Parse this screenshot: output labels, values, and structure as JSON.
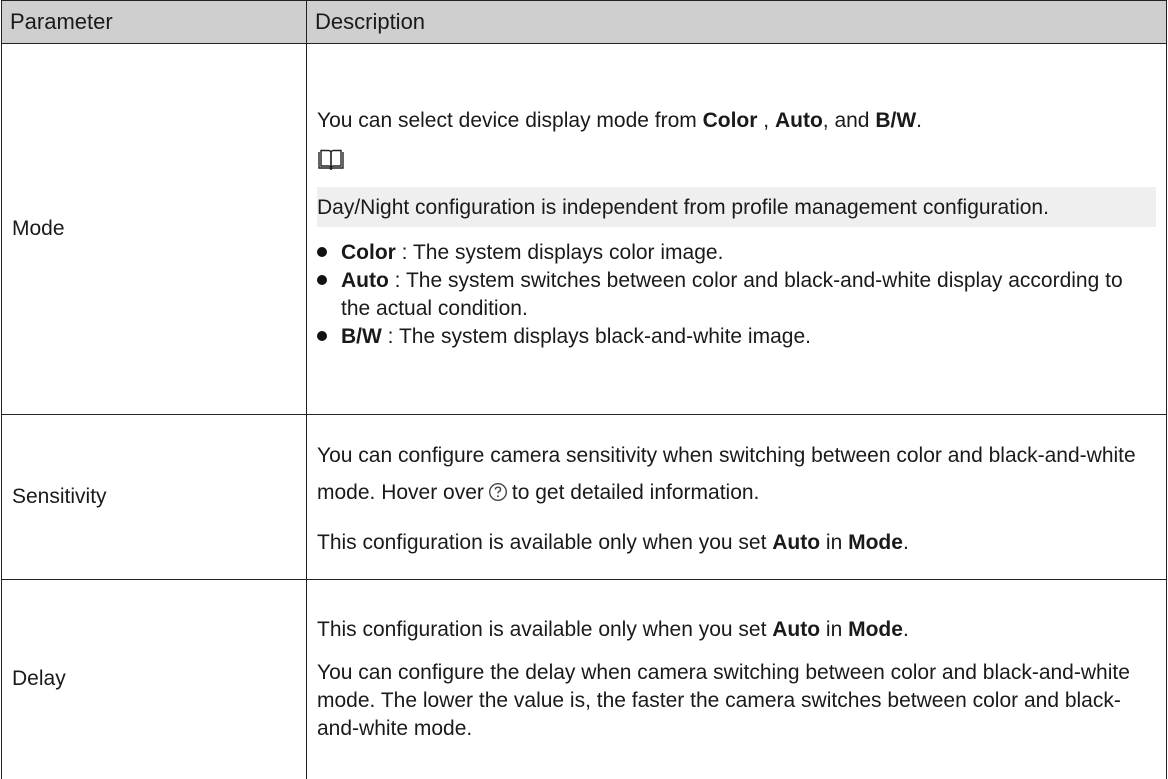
{
  "table": {
    "headers": [
      "Parameter",
      "Description"
    ],
    "rows": {
      "mode": {
        "param": "Mode",
        "intro": {
          "t1": "You can select device display mode from ",
          "b1": "Color",
          "t2": " , ",
          "b2": "Auto",
          "t3": ", and ",
          "b3": "B/W",
          "t4": "."
        },
        "note_icon": "book-note-icon",
        "note": "Day/Night configuration is independent from profile management configuration.",
        "bullets": [
          {
            "term": "Color",
            "text": " : The system displays color image."
          },
          {
            "term": "Auto",
            "text": " : The system switches between color and black-and-white display according to the actual condition."
          },
          {
            "term": "B/W",
            "text": " : The system displays black-and-white image."
          }
        ]
      },
      "sensitivity": {
        "param": "Sensitivity",
        "p1": "You can configure camera sensitivity when switching between color and black-and-white mode. Hover over",
        "help_icon": "question-circle-icon",
        "p1_tail": "to get detailed information.",
        "p2": {
          "t1": "This configuration is available only when you set ",
          "b1": "Auto",
          "t2": "  in ",
          "b2": "Mode",
          "t3": "."
        }
      },
      "delay": {
        "param": "Delay",
        "p1": {
          "t1": "This configuration is available only when you set ",
          "b1": "Auto",
          "t2": "  in ",
          "b2": "Mode",
          "t3": "."
        },
        "p2": "You can configure the delay when camera switching between color and black-and-white mode. The lower the value is, the faster the camera switches between color and black-and-white mode."
      }
    }
  }
}
